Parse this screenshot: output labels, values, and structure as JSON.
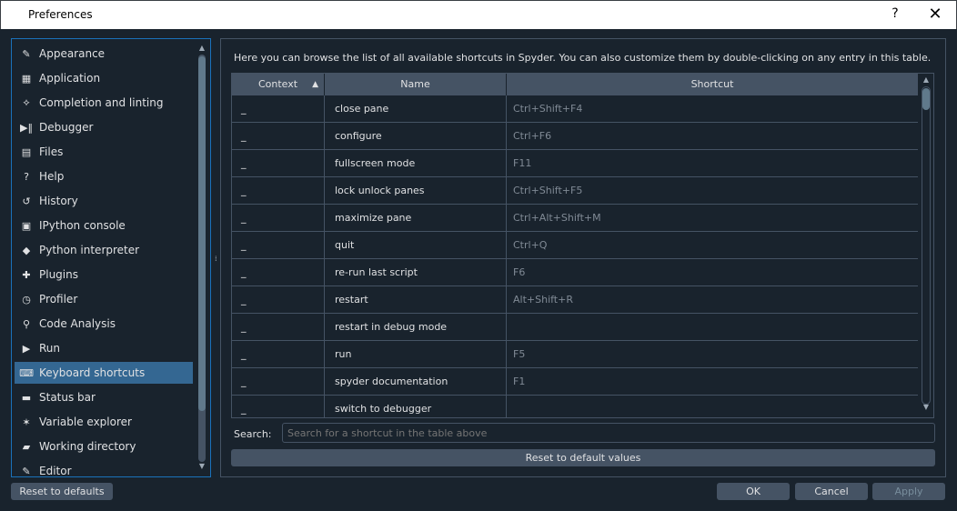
{
  "window": {
    "title": "Preferences",
    "help_glyph": "?",
    "close_glyph": "✕"
  },
  "sidebar": {
    "items": [
      {
        "label": "Appearance",
        "icon": "paintbrush-icon",
        "glyph": "✎"
      },
      {
        "label": "Application",
        "icon": "layout-icon",
        "glyph": "▦"
      },
      {
        "label": "Completion and linting",
        "icon": "completion-icon",
        "glyph": "⟡"
      },
      {
        "label": "Debugger",
        "icon": "debug-icon",
        "glyph": "▶‖"
      },
      {
        "label": "Files",
        "icon": "file-icon",
        "glyph": "▤"
      },
      {
        "label": "Help",
        "icon": "help-icon",
        "glyph": "?"
      },
      {
        "label": "History",
        "icon": "history-icon",
        "glyph": "↺"
      },
      {
        "label": "IPython console",
        "icon": "terminal-icon",
        "glyph": "▣"
      },
      {
        "label": "Python interpreter",
        "icon": "python-icon",
        "glyph": "◆"
      },
      {
        "label": "Plugins",
        "icon": "puzzle-icon",
        "glyph": "✚"
      },
      {
        "label": "Profiler",
        "icon": "stopwatch-icon",
        "glyph": "◷"
      },
      {
        "label": "Code Analysis",
        "icon": "code-analysis-icon",
        "glyph": "⚲"
      },
      {
        "label": "Run",
        "icon": "run-icon",
        "glyph": "▶"
      },
      {
        "label": "Keyboard shortcuts",
        "icon": "keyboard-icon",
        "glyph": "⌨"
      },
      {
        "label": "Status bar",
        "icon": "statusbar-icon",
        "glyph": "▬"
      },
      {
        "label": "Variable explorer",
        "icon": "telescope-icon",
        "glyph": "✶"
      },
      {
        "label": "Working directory",
        "icon": "folder-open-icon",
        "glyph": "▰"
      },
      {
        "label": "Editor",
        "icon": "pencil-icon",
        "glyph": "✎"
      }
    ],
    "selected": "Keyboard shortcuts",
    "scroll_up_glyph": "▲",
    "scroll_down_glyph": "▼"
  },
  "splitter_glyph": "⁞",
  "shortcuts": {
    "intro": "Here you can browse the list of all available shortcuts in Spyder. You can also customize them by double-clicking on any entry in this table.",
    "columns": {
      "context": "Context",
      "name": "Name",
      "shortcut": "Shortcut",
      "sort_glyph": "▲"
    },
    "rows": [
      {
        "context": "_",
        "name": "close pane",
        "shortcut": "Ctrl+Shift+F4"
      },
      {
        "context": "_",
        "name": "configure",
        "shortcut": "Ctrl+F6"
      },
      {
        "context": "_",
        "name": "fullscreen mode",
        "shortcut": "F11"
      },
      {
        "context": "_",
        "name": "lock unlock panes",
        "shortcut": "Ctrl+Shift+F5"
      },
      {
        "context": "_",
        "name": "maximize pane",
        "shortcut": "Ctrl+Alt+Shift+M"
      },
      {
        "context": "_",
        "name": "quit",
        "shortcut": "Ctrl+Q"
      },
      {
        "context": "_",
        "name": "re-run last script",
        "shortcut": "F6"
      },
      {
        "context": "_",
        "name": "restart",
        "shortcut": "Alt+Shift+R"
      },
      {
        "context": "_",
        "name": "restart in debug mode",
        "shortcut": ""
      },
      {
        "context": "_",
        "name": "run",
        "shortcut": "F5"
      },
      {
        "context": "_",
        "name": "spyder documentation",
        "shortcut": "F1"
      },
      {
        "context": "_",
        "name": "switch to debugger",
        "shortcut": ""
      }
    ],
    "scroll_up_glyph": "▲",
    "scroll_down_glyph": "▼",
    "search_label": "Search:",
    "search_placeholder": "Search for a shortcut in the table above",
    "reset_label": "Reset to default values"
  },
  "buttons": {
    "reset_defaults": "Reset to defaults",
    "ok": "OK",
    "cancel": "Cancel",
    "apply": "Apply"
  },
  "colors": {
    "background": "#19232d",
    "selection": "#346792",
    "border_focus": "#1a72bb",
    "button": "#455364",
    "text": "#e0e1e3",
    "muted_text": "#808a95"
  }
}
